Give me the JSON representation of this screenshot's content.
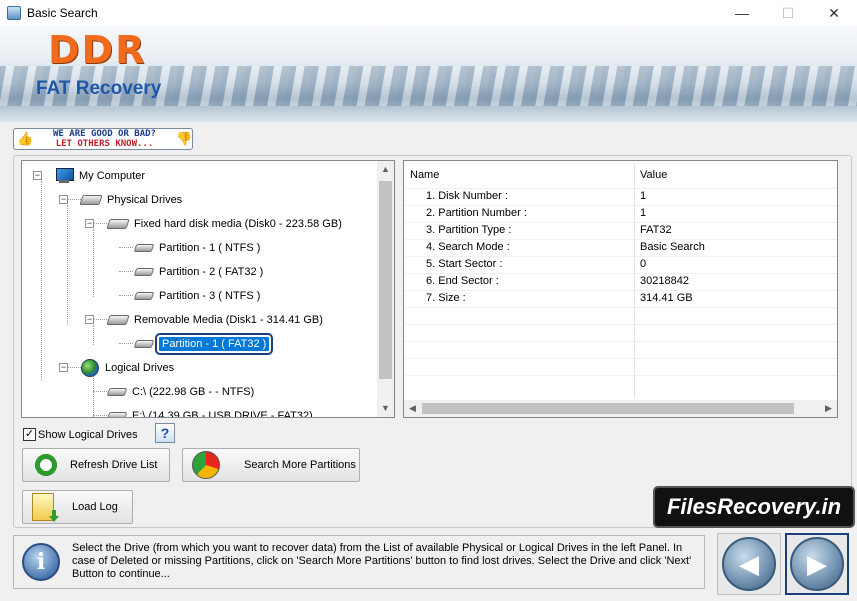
{
  "window": {
    "title": "Basic Search",
    "controls": {
      "minimize": "—",
      "maximize": "☐",
      "close": "✕"
    }
  },
  "banner": {
    "logo": "DDR",
    "product": "FAT Recovery"
  },
  "feedback": {
    "line1": "WE ARE GOOD OR BAD?",
    "line2": "LET OTHERS KNOW..."
  },
  "tree": {
    "my_computer": "My Computer",
    "physical_drives": "Physical Drives",
    "disk0": "Fixed hard disk media (Disk0 - 223.58 GB)",
    "disk0_partitions": [
      "Partition - 1 ( NTFS )",
      "Partition - 2 ( FAT32 )",
      "Partition - 3 ( NTFS )"
    ],
    "disk1": "Removable Media (Disk1 - 314.41 GB)",
    "disk1_partitions": [
      "Partition - 1 ( FAT32 )"
    ],
    "logical_drives": "Logical Drives",
    "logical": [
      "C:\\ (222.98 GB -  - NTFS)",
      "E:\\ (14.39 GB - USB DRIVE - FAT32)"
    ]
  },
  "grid": {
    "headers": {
      "name": "Name",
      "value": "Value"
    },
    "rows": [
      {
        "name": "1. Disk Number :",
        "value": "1"
      },
      {
        "name": "2. Partition Number :",
        "value": "1"
      },
      {
        "name": "3. Partition Type :",
        "value": "FAT32"
      },
      {
        "name": "4. Search Mode :",
        "value": "Basic Search"
      },
      {
        "name": "5. Start Sector :",
        "value": "0"
      },
      {
        "name": "6. End Sector :",
        "value": "30218842"
      },
      {
        "name": "7. Size :",
        "value": "314.41 GB"
      }
    ]
  },
  "options": {
    "show_logical": "Show Logical Drives",
    "show_logical_checked": true,
    "help": "?"
  },
  "buttons": {
    "refresh": "Refresh Drive List",
    "search_more": "Search More Partitions",
    "load_log": "Load Log"
  },
  "brand": "FilesRecovery.in",
  "info": {
    "text": "Select the Drive (from which you want to recover data) from the List of available Physical or Logical Drives in the left Panel. In case of Deleted or missing Partitions, click on 'Search More Partitions' button to find lost drives. Select the Drive and click 'Next' Button to continue..."
  },
  "nav": {
    "back": "◀",
    "next": "▶"
  }
}
